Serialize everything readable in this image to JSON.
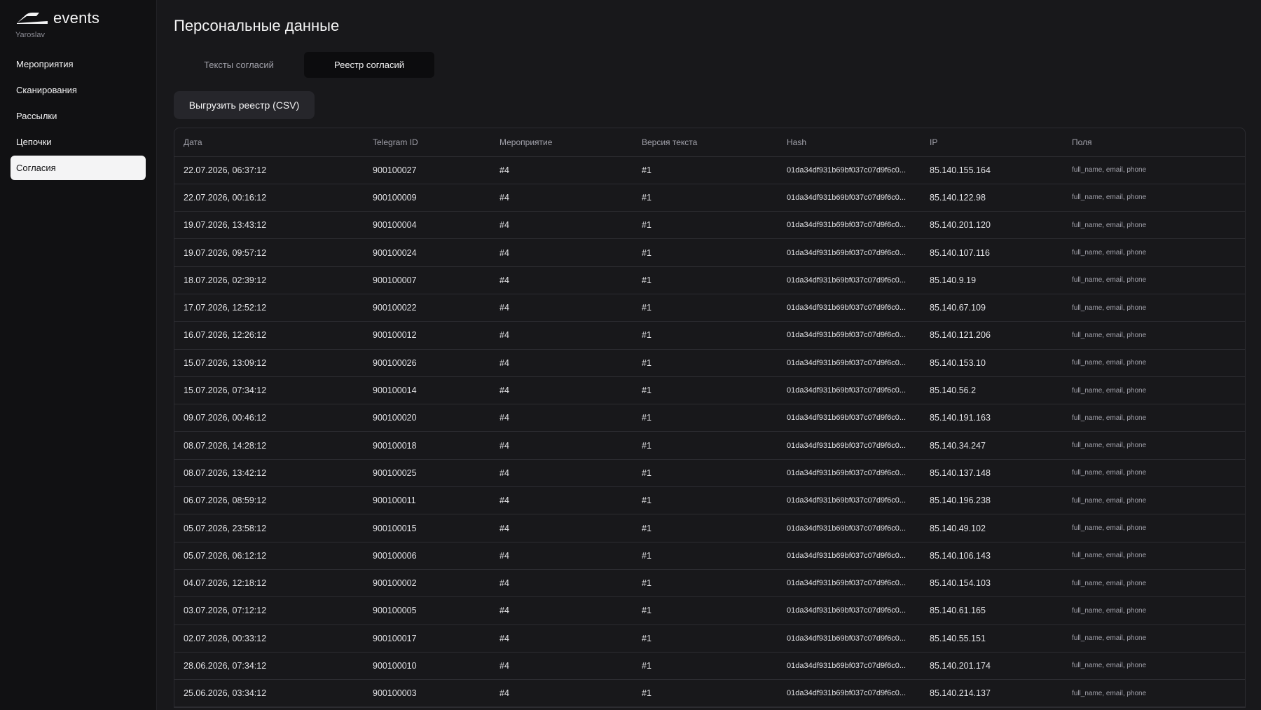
{
  "brand": {
    "name": "events",
    "user": "Yaroslav",
    "logo_icon": "events-logo-icon"
  },
  "nav": {
    "items": [
      {
        "label": "Мероприятия",
        "active": false
      },
      {
        "label": "Сканирования",
        "active": false
      },
      {
        "label": "Рассылки",
        "active": false
      },
      {
        "label": "Цепочки",
        "active": false
      },
      {
        "label": "Согласия",
        "active": true
      }
    ]
  },
  "page": {
    "title": "Персональные данные"
  },
  "tabs": [
    {
      "label": "Тексты согласий",
      "active": false
    },
    {
      "label": "Реестр согласий",
      "active": true
    }
  ],
  "actions": {
    "export_label": "Выгрузить реестр (CSV)"
  },
  "colors": {
    "background": "#18181b",
    "sidebar": "#111113",
    "active_nav": "#f4f4f5",
    "border": "#2c2c31"
  },
  "table": {
    "columns": [
      "Дата",
      "Telegram ID",
      "Мероприятие",
      "Версия текста",
      "Hash",
      "IP",
      "Поля"
    ],
    "rows": [
      [
        "22.07.2026, 06:37:12",
        "900100027",
        "#4",
        "#1",
        "01da34df931b69bf037c07d9f6c0...",
        "85.140.155.164",
        "full_name, email, phone"
      ],
      [
        "22.07.2026, 00:16:12",
        "900100009",
        "#4",
        "#1",
        "01da34df931b69bf037c07d9f6c0...",
        "85.140.122.98",
        "full_name, email, phone"
      ],
      [
        "19.07.2026, 13:43:12",
        "900100004",
        "#4",
        "#1",
        "01da34df931b69bf037c07d9f6c0...",
        "85.140.201.120",
        "full_name, email, phone"
      ],
      [
        "19.07.2026, 09:57:12",
        "900100024",
        "#4",
        "#1",
        "01da34df931b69bf037c07d9f6c0...",
        "85.140.107.116",
        "full_name, email, phone"
      ],
      [
        "18.07.2026, 02:39:12",
        "900100007",
        "#4",
        "#1",
        "01da34df931b69bf037c07d9f6c0...",
        "85.140.9.19",
        "full_name, email, phone"
      ],
      [
        "17.07.2026, 12:52:12",
        "900100022",
        "#4",
        "#1",
        "01da34df931b69bf037c07d9f6c0...",
        "85.140.67.109",
        "full_name, email, phone"
      ],
      [
        "16.07.2026, 12:26:12",
        "900100012",
        "#4",
        "#1",
        "01da34df931b69bf037c07d9f6c0...",
        "85.140.121.206",
        "full_name, email, phone"
      ],
      [
        "15.07.2026, 13:09:12",
        "900100026",
        "#4",
        "#1",
        "01da34df931b69bf037c07d9f6c0...",
        "85.140.153.10",
        "full_name, email, phone"
      ],
      [
        "15.07.2026, 07:34:12",
        "900100014",
        "#4",
        "#1",
        "01da34df931b69bf037c07d9f6c0...",
        "85.140.56.2",
        "full_name, email, phone"
      ],
      [
        "09.07.2026, 00:46:12",
        "900100020",
        "#4",
        "#1",
        "01da34df931b69bf037c07d9f6c0...",
        "85.140.191.163",
        "full_name, email, phone"
      ],
      [
        "08.07.2026, 14:28:12",
        "900100018",
        "#4",
        "#1",
        "01da34df931b69bf037c07d9f6c0...",
        "85.140.34.247",
        "full_name, email, phone"
      ],
      [
        "08.07.2026, 13:42:12",
        "900100025",
        "#4",
        "#1",
        "01da34df931b69bf037c07d9f6c0...",
        "85.140.137.148",
        "full_name, email, phone"
      ],
      [
        "06.07.2026, 08:59:12",
        "900100011",
        "#4",
        "#1",
        "01da34df931b69bf037c07d9f6c0...",
        "85.140.196.238",
        "full_name, email, phone"
      ],
      [
        "05.07.2026, 23:58:12",
        "900100015",
        "#4",
        "#1",
        "01da34df931b69bf037c07d9f6c0...",
        "85.140.49.102",
        "full_name, email, phone"
      ],
      [
        "05.07.2026, 06:12:12",
        "900100006",
        "#4",
        "#1",
        "01da34df931b69bf037c07d9f6c0...",
        "85.140.106.143",
        "full_name, email, phone"
      ],
      [
        "04.07.2026, 12:18:12",
        "900100002",
        "#4",
        "#1",
        "01da34df931b69bf037c07d9f6c0...",
        "85.140.154.103",
        "full_name, email, phone"
      ],
      [
        "03.07.2026, 07:12:12",
        "900100005",
        "#4",
        "#1",
        "01da34df931b69bf037c07d9f6c0...",
        "85.140.61.165",
        "full_name, email, phone"
      ],
      [
        "02.07.2026, 00:33:12",
        "900100017",
        "#4",
        "#1",
        "01da34df931b69bf037c07d9f6c0...",
        "85.140.55.151",
        "full_name, email, phone"
      ],
      [
        "28.06.2026, 07:34:12",
        "900100010",
        "#4",
        "#1",
        "01da34df931b69bf037c07d9f6c0...",
        "85.140.201.174",
        "full_name, email, phone"
      ],
      [
        "25.06.2026, 03:34:12",
        "900100003",
        "#4",
        "#1",
        "01da34df931b69bf037c07d9f6c0...",
        "85.140.214.137",
        "full_name, email, phone"
      ]
    ]
  }
}
